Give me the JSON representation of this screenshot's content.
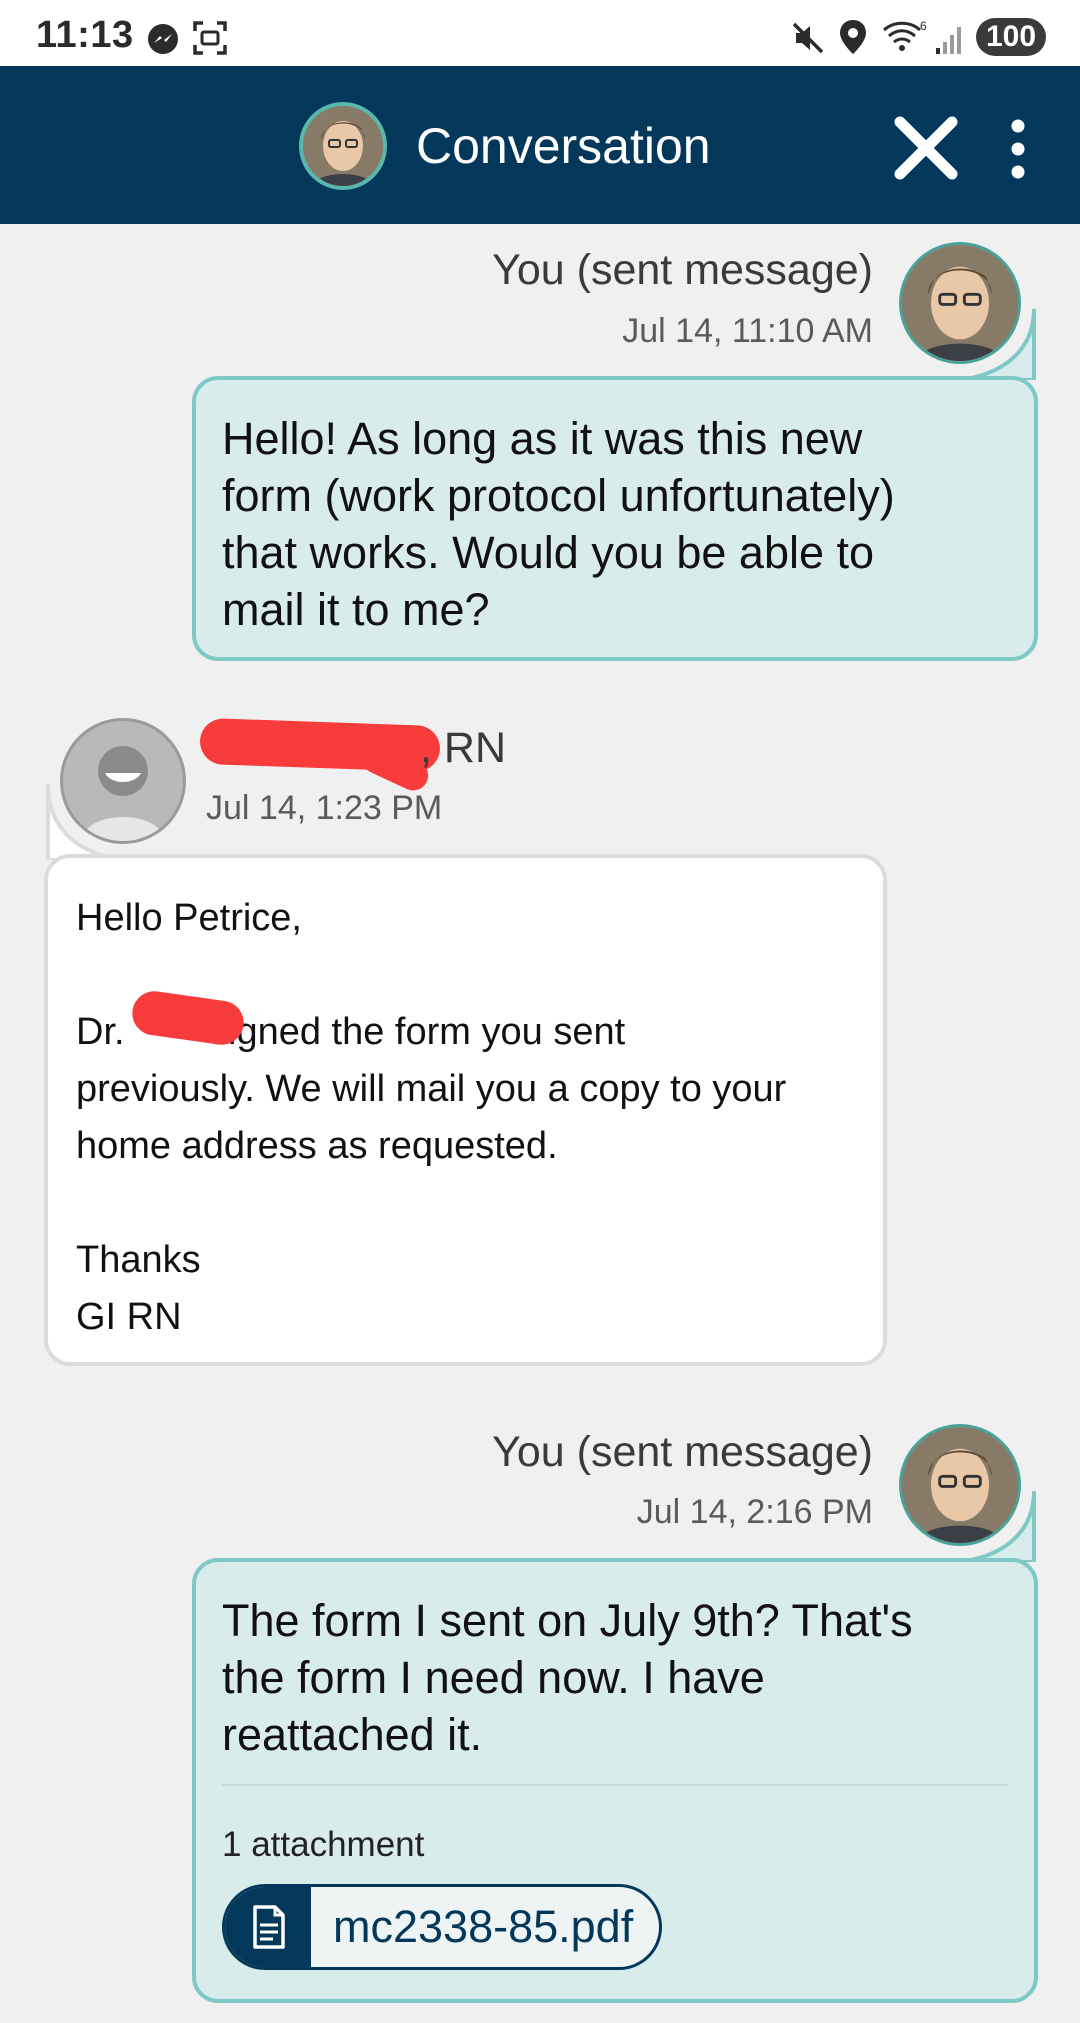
{
  "status_bar": {
    "time": "11:13",
    "battery": "100",
    "icons": [
      "messenger-icon",
      "screenshot-icon",
      "mute-icon",
      "location-icon",
      "wifi-icon",
      "signal-icon"
    ]
  },
  "header": {
    "title": "Conversation",
    "close_icon": "close-icon",
    "more_icon": "more-vertical-icon",
    "color": "#03385a"
  },
  "messages": [
    {
      "sender": "You (sent message)",
      "timestamp": "Jul 14, 11:10 AM",
      "lines": [
        "Hello! As long as it was this new",
        "form (work protocol unfortunately)",
        "that works. Would you be able to",
        "mail it to me?"
      ]
    },
    {
      "sender_suffix": ", RN",
      "timestamp": "Jul 14, 1:23 PM",
      "lines": [
        "Hello Petrice,",
        "",
        "Dr.        signed the form you sent",
        "previously. We will mail you a copy to your",
        "home address as requested.",
        "",
        "Thanks",
        "GI RN"
      ]
    },
    {
      "sender": "You (sent message)",
      "timestamp": "Jul 14, 2:16 PM",
      "lines": [
        "The form I sent on July 9th? That's",
        "the form I need now. I have",
        "reattached it."
      ],
      "attachment_count": "1 attachment",
      "attachment_name": "mc2338-85.pdf"
    }
  ],
  "colors": {
    "outgoing_bubble": "#d8ecec",
    "outgoing_border": "#7ec8c6",
    "incoming_bubble": "#ffffff",
    "redaction": "#f83b3b"
  }
}
